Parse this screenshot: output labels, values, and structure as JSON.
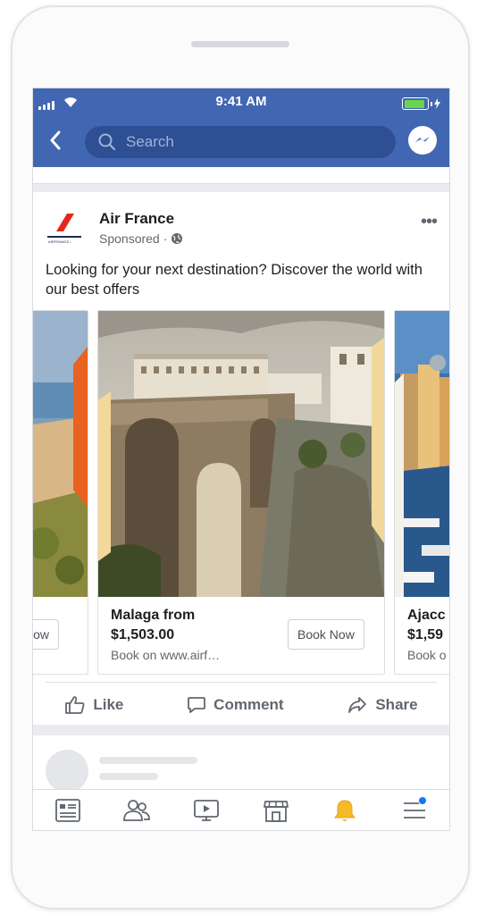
{
  "status_bar": {
    "time": "9:41 AM"
  },
  "search": {
    "placeholder": "Search"
  },
  "post": {
    "page_name": "Air France",
    "sponsored": "Sponsored",
    "message": "Looking for your next destination? Discover the world with our best offers",
    "logo_caption": "AIRFRANCE /",
    "carousel": [
      {
        "title": "",
        "price": "",
        "site": "",
        "button": "Now"
      },
      {
        "title": "Malaga from",
        "price": "$1,503.00",
        "site": "Book on www.airf…",
        "button": "Book Now"
      },
      {
        "title": "Ajacc",
        "price": "$1,59",
        "site": "Book o",
        "button": ""
      }
    ],
    "actions": {
      "like": "Like",
      "comment": "Comment",
      "share": "Share"
    }
  },
  "tab_bar": {
    "items": [
      "news-feed-icon",
      "friends-icon",
      "watch-icon",
      "marketplace-icon",
      "notifications-icon",
      "menu-icon"
    ],
    "active_color": "#f7b928",
    "badge_color": "#1877f2"
  },
  "colors": {
    "brand": "#4267b2",
    "airfrance_red": "#e3271d"
  }
}
